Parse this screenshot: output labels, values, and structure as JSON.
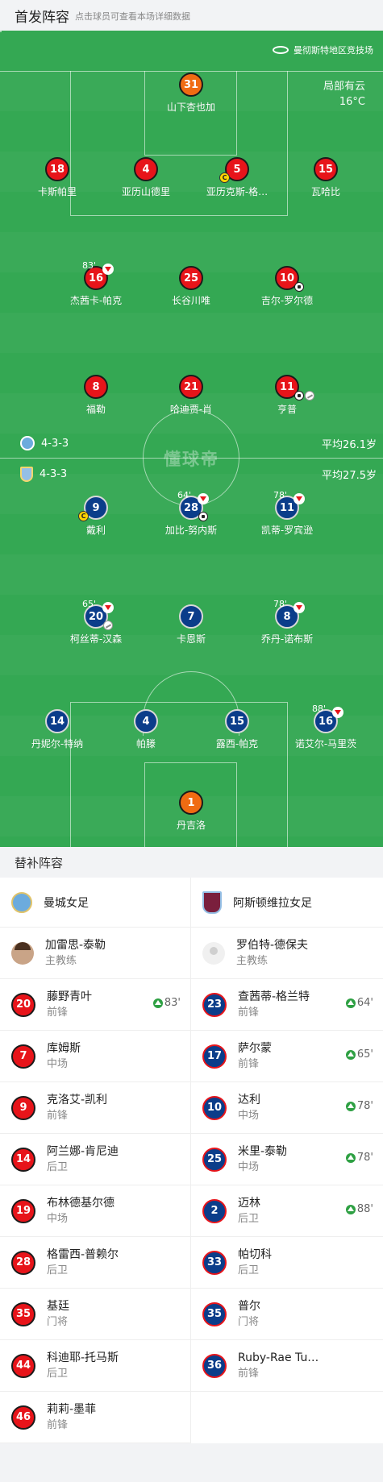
{
  "header": {
    "title": "首发阵容",
    "subtitle": "点击球员可查看本场详细数据"
  },
  "pitch": {
    "venue": "曼彻斯特地区竞技场",
    "weather": "局部有云",
    "temperature": "16°C",
    "watermark": "懂球帝",
    "home": {
      "formation": "4-3-3",
      "avg_age": "平均26.1岁"
    },
    "away": {
      "formation": "4-3-3",
      "avg_age": "平均27.5岁"
    },
    "home_players": [
      {
        "num": "31",
        "name": "山下杏也加"
      },
      {
        "num": "18",
        "name": "卡斯帕里"
      },
      {
        "num": "4",
        "name": "亚历山德里"
      },
      {
        "num": "5",
        "name": "亚历克斯-格…"
      },
      {
        "num": "15",
        "name": "瓦哈比"
      },
      {
        "num": "16",
        "name": "杰茜卡-帕克",
        "sub_min": "83'"
      },
      {
        "num": "25",
        "name": "长谷川唯"
      },
      {
        "num": "10",
        "name": "吉尔-罗尔德"
      },
      {
        "num": "8",
        "name": "福勒"
      },
      {
        "num": "21",
        "name": "哈迪贾-肖"
      },
      {
        "num": "11",
        "name": "亨普"
      }
    ],
    "away_players": [
      {
        "num": "9",
        "name": "戴利"
      },
      {
        "num": "28",
        "name": "加比-努内斯",
        "sub_min": "64'"
      },
      {
        "num": "11",
        "name": "凯蒂-罗宾逊",
        "sub_min": "78'"
      },
      {
        "num": "20",
        "name": "柯丝蒂-汉森",
        "sub_min": "65'"
      },
      {
        "num": "7",
        "name": "卡恩斯"
      },
      {
        "num": "8",
        "name": "乔丹-诺布斯",
        "sub_min": "78'"
      },
      {
        "num": "14",
        "name": "丹妮尔-特纳"
      },
      {
        "num": "4",
        "name": "帕滕"
      },
      {
        "num": "15",
        "name": "露西-帕克"
      },
      {
        "num": "16",
        "name": "诺艾尔-马里茨",
        "sub_min": "88'"
      },
      {
        "num": "1",
        "name": "丹吉洛"
      }
    ],
    "captain_badge": "C"
  },
  "subs": {
    "title": "替补阵容",
    "home": {
      "team": "曼城女足",
      "coach": {
        "name": "加雷思-泰勒",
        "role": "主教练"
      },
      "players": [
        {
          "num": "20",
          "name": "藤野青叶",
          "pos": "前锋",
          "in": "83'"
        },
        {
          "num": "7",
          "name": "库姆斯",
          "pos": "中场"
        },
        {
          "num": "9",
          "name": "克洛艾-凯利",
          "pos": "前锋"
        },
        {
          "num": "14",
          "name": "阿兰娜-肯尼迪",
          "pos": "后卫"
        },
        {
          "num": "19",
          "name": "布林德基尔德",
          "pos": "中场"
        },
        {
          "num": "28",
          "name": "格雷西-普赖尔",
          "pos": "后卫"
        },
        {
          "num": "35",
          "name": "基廷",
          "pos": "门将"
        },
        {
          "num": "44",
          "name": "科迪耶-托马斯",
          "pos": "后卫"
        },
        {
          "num": "46",
          "name": "莉莉-墨菲",
          "pos": "前锋"
        }
      ]
    },
    "away": {
      "team": "阿斯顿维拉女足",
      "coach": {
        "name": "罗伯特-德保夫",
        "role": "主教练"
      },
      "players": [
        {
          "num": "23",
          "name": "查茜蒂-格兰特",
          "pos": "前锋",
          "in": "64'"
        },
        {
          "num": "17",
          "name": "萨尔蒙",
          "pos": "前锋",
          "in": "65'"
        },
        {
          "num": "10",
          "name": "达利",
          "pos": "中场",
          "in": "78'"
        },
        {
          "num": "25",
          "name": "米里-泰勒",
          "pos": "中场",
          "in": "78'"
        },
        {
          "num": "2",
          "name": "迈林",
          "pos": "后卫",
          "in": "88'"
        },
        {
          "num": "33",
          "name": "帕切科",
          "pos": "后卫"
        },
        {
          "num": "35",
          "name": "普尔",
          "pos": "门将"
        },
        {
          "num": "36",
          "name": "Ruby-Rae Tu…",
          "pos": "前锋"
        }
      ]
    }
  },
  "colors": {
    "pitch": "#34a853",
    "home": "#e7141a",
    "away": "#0b3d8a",
    "gk": "#f06b12"
  }
}
